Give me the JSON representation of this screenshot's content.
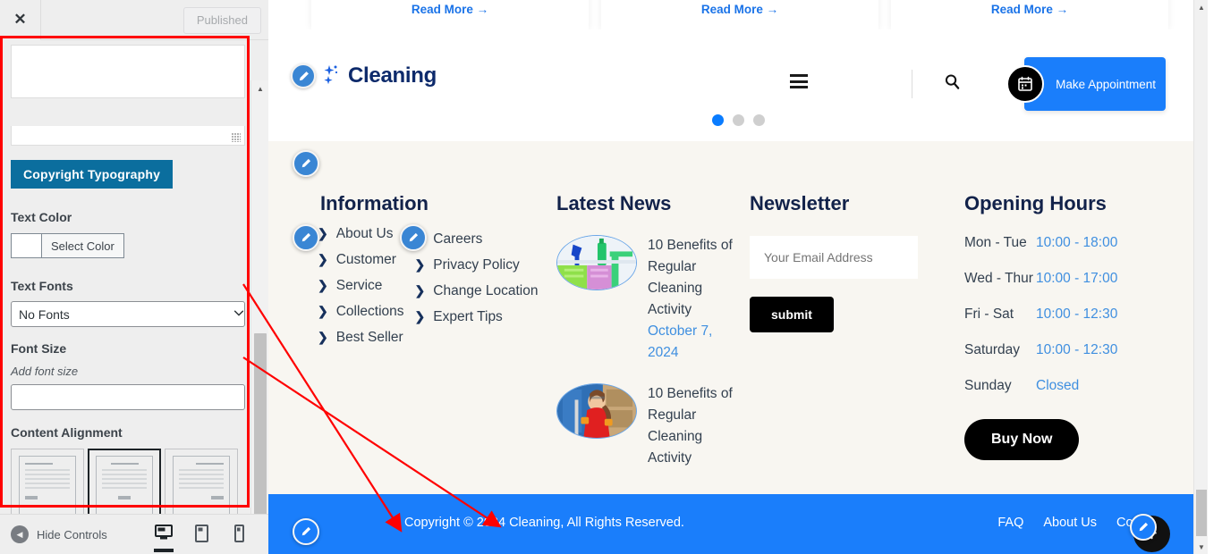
{
  "customizer": {
    "close_icon": "close-icon",
    "published_label": "Published",
    "copyright_textarea_value": "",
    "typography_button_label": "Copyright Typography",
    "text_color": {
      "label": "Text Color",
      "select_label": "Select Color",
      "swatch_hex": "#ffffff"
    },
    "text_fonts": {
      "label": "Text Fonts",
      "selected": "No Fonts",
      "options": [
        "No Fonts"
      ]
    },
    "font_size": {
      "label": "Font Size",
      "hint": "Add font size",
      "value": "",
      "placeholder": ""
    },
    "content_alignment": {
      "label": "Content Alignment",
      "options": [
        "left",
        "center",
        "right"
      ],
      "selected": "center"
    },
    "footer": {
      "hide_controls_label": "Hide Controls",
      "devices": [
        "desktop",
        "tablet",
        "mobile"
      ],
      "active_device": "desktop"
    }
  },
  "preview": {
    "top_cards": [
      {
        "read_more": "Read More →"
      },
      {
        "read_more": "Read More →"
      },
      {
        "read_more": "Read More →"
      }
    ],
    "header": {
      "brand_name": "Cleaning",
      "menu_icon": "hamburger-icon",
      "search_icon": "search-icon",
      "appointment_label": "Make Appointment",
      "appointment_icon": "calendar-icon",
      "carousel_dots": 3,
      "carousel_active_index": 0,
      "accent_hex": "#1a7efb"
    },
    "footer": {
      "information": {
        "title": "Information",
        "column_one": [
          "About Us",
          "Customer",
          "Service",
          "Collections",
          "Best Seller"
        ],
        "column_two": [
          "Careers",
          "Privacy Policy",
          "Change Location",
          "Expert Tips"
        ]
      },
      "latest_news": {
        "title": "Latest News",
        "items": [
          {
            "title": "10 Benefits of Regular Cleaning Activity",
            "date": "October 7, 2024"
          },
          {
            "title": "10 Benefits of Regular Cleaning Activity",
            "date": ""
          }
        ]
      },
      "newsletter": {
        "title": "Newsletter",
        "email_placeholder": "Your Email Address",
        "email_value": "",
        "submit_label": "submit"
      },
      "opening_hours": {
        "title": "Opening Hours",
        "rows": [
          {
            "day": "Mon - Tue",
            "time": "10:00 - 18:00"
          },
          {
            "day": "Wed - Thur",
            "time": "10:00 - 17:00"
          },
          {
            "day": "Fri - Sat",
            "time": "10:00 - 12:30"
          },
          {
            "day": "Saturday",
            "time": "10:00 - 12:30"
          },
          {
            "day": "Sunday",
            "time": "Closed"
          }
        ],
        "buy_now_label": "Buy Now"
      },
      "bottom": {
        "copyright": "Copyright © 2024 Cleaning, All Rights Reserved.",
        "links": [
          "FAQ",
          "About Us",
          "Contact"
        ],
        "scroll_top_icon": "arrow-up-icon",
        "bar_hex": "#1a7efb"
      }
    }
  },
  "annotations": {
    "highlight_hex": "#ff0000"
  }
}
